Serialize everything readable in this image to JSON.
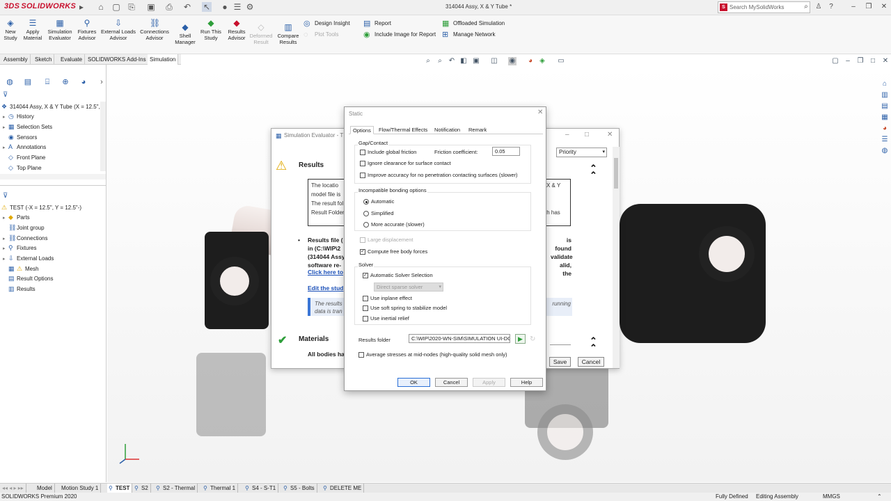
{
  "app": {
    "brand": "SOLIDWORKS",
    "document_title": "314044 Assy, X & Y Tube *",
    "search_placeholder": "Search MySolidWorks"
  },
  "ribbon": {
    "buttons": [
      {
        "label": "New\nStudy"
      },
      {
        "label": "Apply\nMaterial"
      },
      {
        "label": "Simulation\nEvaluator"
      },
      {
        "label": "Fixtures\nAdvisor"
      },
      {
        "label": "External Loads\nAdvisor"
      },
      {
        "label": "Connections\nAdvisor"
      },
      {
        "label": "Shell\nManager"
      },
      {
        "label": "Run This\nStudy"
      },
      {
        "label": "Results\nAdvisor"
      },
      {
        "label": "Deformed\nResult"
      },
      {
        "label": "Compare\nResults"
      }
    ],
    "small": {
      "design_insight": "Design Insight",
      "plot_tools": "Plot Tools",
      "report": "Report",
      "include_image": "Include Image for Report",
      "offloaded": "Offloaded Simulation",
      "manage_network": "Manage Network"
    }
  },
  "command_tabs": [
    "Assembly",
    "Sketch",
    "Evaluate",
    "SOLIDWORKS Add-Ins",
    "Simulation"
  ],
  "feature_tree": {
    "root": "314044 Assy, X & Y Tube  (X = 12.5\",",
    "items": [
      "History",
      "Selection Sets",
      "Sensors",
      "Annotations",
      "Front Plane",
      "Top Plane"
    ]
  },
  "study_tree": {
    "root": "TEST (-X = 12.5\", Y = 12.5\"-)",
    "items": [
      "Parts",
      "Joint group",
      "Connections",
      "Fixtures",
      "External Loads",
      "Mesh",
      "Result Options",
      "Results"
    ]
  },
  "evaluator": {
    "title": "Simulation Evaluator - T",
    "priority": "Priority",
    "results_title": "Results",
    "box_lines": [
      "The      locatio",
      "model file is",
      "The result fol",
      "Result Folder"
    ],
    "box_right": [
      "X  &  Y",
      "th     has"
    ],
    "results_file_lines": [
      "Results file (",
      "in (C:\\WIP\\2",
      "(314044 Assy",
      "software re-"
    ],
    "results_file_right": [
      "is found",
      "validate",
      "alid, the"
    ],
    "link_click": "Click here to",
    "link_edit": "Edit the stud",
    "note_lines": [
      "The results",
      "data is tran"
    ],
    "note_right": "running",
    "materials_title": "Materials",
    "all_bodies": "All bodies ha",
    "save": "Save",
    "cancel": "Cancel"
  },
  "static_dialog": {
    "title": "Static",
    "tabs": [
      "Options",
      "Flow/Thermal Effects",
      "Notification",
      "Remark"
    ],
    "gap_contact": {
      "label": "Gap/Contact",
      "include_global_friction": "Include global friction",
      "friction_label": "Friction coefficient:",
      "friction_value": "0.05",
      "ignore_clearance": "Ignore clearance for surface contact",
      "improve_accuracy": "Improve accuracy for no penetration contacting surfaces (slower)"
    },
    "incompatible": {
      "label": "Incompatible bonding options",
      "options": [
        "Automatic",
        "Simplified",
        "More accurate (slower)"
      ],
      "selected": "Automatic"
    },
    "large_displacement": "Large displacement",
    "compute_free_body": "Compute free body forces",
    "solver": {
      "label": "Solver",
      "automatic": "Automatic Solver Selection",
      "solver_value": "Direct sparse solver",
      "inplane": "Use inplane effect",
      "soft_spring": "Use soft spring to stabilize model",
      "inertial": "Use inertial relief"
    },
    "results_folder_label": "Results folder",
    "results_folder_value": "C:\\WIP\\2020-WN-SIM\\SIMULATION UI-DC",
    "average_stresses": "Average stresses at mid-nodes (high-quality solid mesh only)",
    "buttons": {
      "ok": "OK",
      "cancel": "Cancel",
      "apply": "Apply",
      "help": "Help"
    }
  },
  "bottom_tabs": [
    "Model",
    "Motion Study 1",
    "TEST",
    "S2",
    "S2 - Thermal",
    "Thermal 1",
    "S4 - S-T1",
    "S5 - Bolts",
    "DELETE ME"
  ],
  "status": {
    "product": "SOLIDWORKS Premium 2020",
    "defined": "Fully Defined",
    "editing": "Editing Assembly",
    "units": "MMGS"
  },
  "colors": {
    "brand_red": "#c8102e",
    "accent_blue": "#2b5fa8",
    "link": "#1a4fb8"
  }
}
